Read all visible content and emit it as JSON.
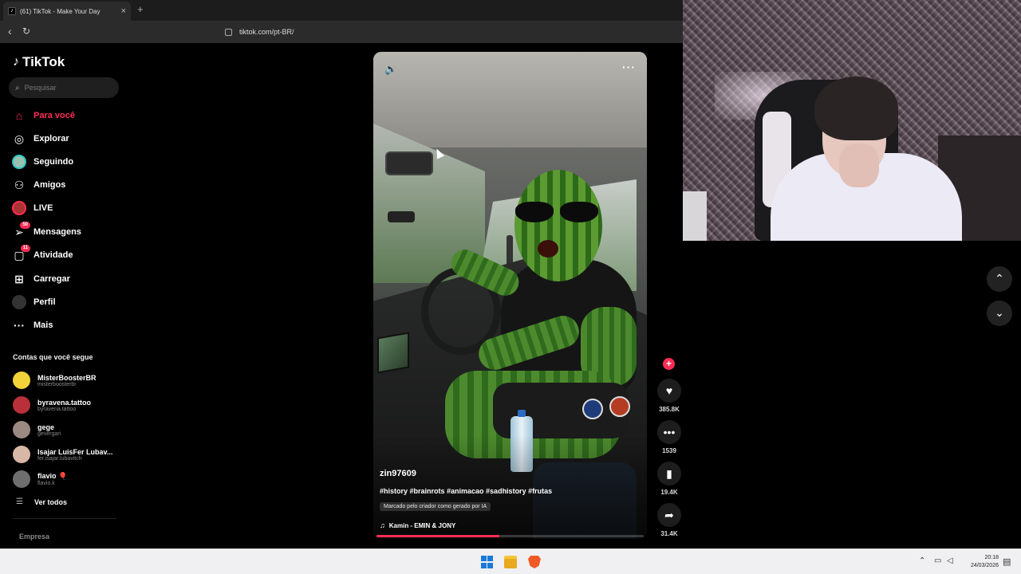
{
  "browser": {
    "tab_title": "(61) TikTok - Make Your Day",
    "tab_favicon": "tiktok-note-icon",
    "new_tab_label": "+",
    "url": "tiktok.com/pt-BR/"
  },
  "sidebar": {
    "logo": "TikTok",
    "search_placeholder": "Pesquisar",
    "menu": [
      {
        "label": "Para você",
        "icon": "home-icon",
        "active": true
      },
      {
        "label": "Explorar",
        "icon": "compass-icon"
      },
      {
        "label": "Seguindo",
        "icon": "following-avatar-icon"
      },
      {
        "label": "Amigos",
        "icon": "friends-icon"
      },
      {
        "label": "LIVE",
        "icon": "live-icon"
      },
      {
        "label": "Mensagens",
        "icon": "paper-plane-icon",
        "badge": "50"
      },
      {
        "label": "Atividade",
        "icon": "inbox-icon",
        "badge": "11"
      },
      {
        "label": "Carregar",
        "icon": "plus-square-icon"
      },
      {
        "label": "Perfil",
        "icon": "profile-avatar-icon"
      },
      {
        "label": "Mais",
        "icon": "more-dots-icon"
      }
    ],
    "following_title": "Contas que você segue",
    "following": [
      {
        "name": "MisterBoosterBR",
        "handle": "misterboosterbr",
        "color": "#f3d23a"
      },
      {
        "name": "byravena.tattoo",
        "handle": "byravena.tattoo",
        "color": "#b9303a"
      },
      {
        "name": "gege",
        "handle": "gevergari",
        "color": "#9b8a82"
      },
      {
        "name": "Isajar LuisFer Lubav...",
        "handle": "fer.isajar.lubavitch",
        "color": "#d8b7a7"
      },
      {
        "name": "flavio 🎈",
        "handle": "flavio.k",
        "color": "#6e6e6e"
      }
    ],
    "see_all": "Ver todos",
    "company": "Empresa"
  },
  "video": {
    "username": "zin97609",
    "hashtags": "#history #brainrots #animacao #sadhistory #frutas",
    "ai_label": "Marcado pelo criador como gerado por IA",
    "music": "Kamin - EMIN & JONY",
    "progress": 0.46
  },
  "actions": {
    "likes": "385.8K",
    "comments": "1539",
    "saves": "19.4K",
    "shares": "31.4K"
  },
  "taskbar": {
    "time": "20:18",
    "date": "24/03/2026"
  },
  "colors": {
    "accent": "#fe2c55",
    "background": "#000000"
  }
}
